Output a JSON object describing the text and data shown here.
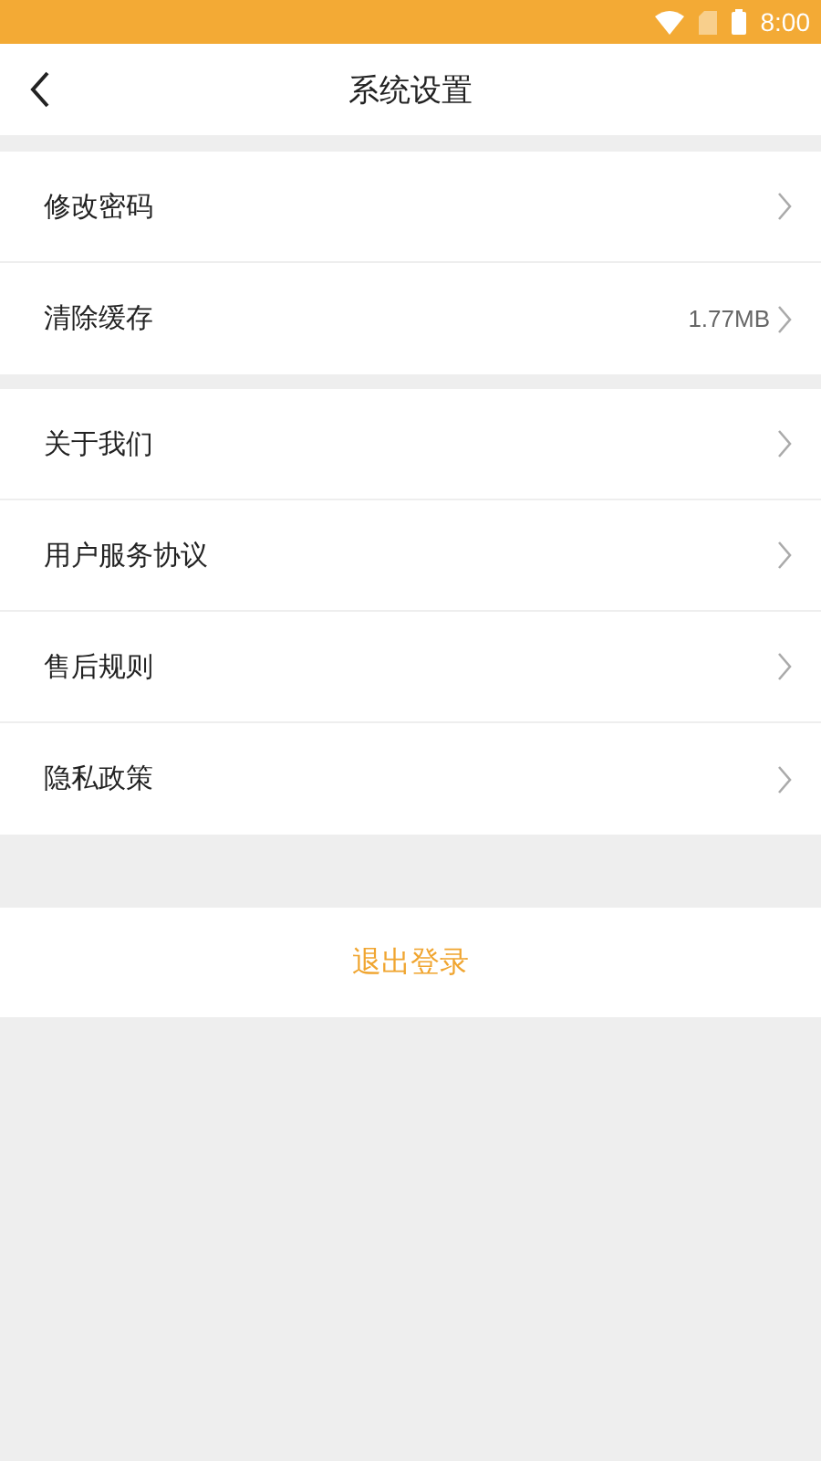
{
  "status_bar": {
    "time": "8:00"
  },
  "header": {
    "title": "系统设置"
  },
  "groups": [
    [
      {
        "label": "修改密码"
      },
      {
        "label": "清除缓存",
        "value": "1.77MB"
      }
    ],
    [
      {
        "label": "关于我们"
      },
      {
        "label": "用户服务协议"
      },
      {
        "label": "售后规则"
      },
      {
        "label": "隐私政策"
      }
    ]
  ],
  "logout": {
    "label": "退出登录"
  }
}
